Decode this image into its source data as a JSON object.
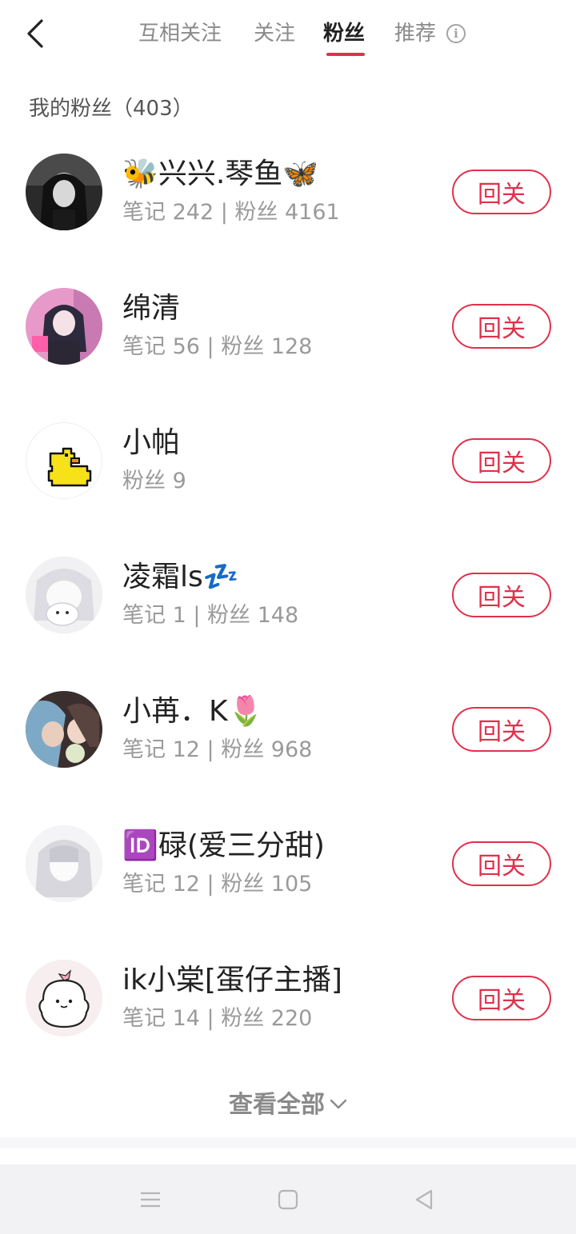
{
  "header": {
    "tabs": [
      {
        "label": "互相关注"
      },
      {
        "label": "关注"
      },
      {
        "label": "粉丝"
      },
      {
        "label": "推荐"
      }
    ],
    "active_tab": "粉丝",
    "info_glyph": "i"
  },
  "section": {
    "title": "我的粉丝（403）"
  },
  "fans": [
    {
      "name": "🐝兴兴.琴鱼🦋",
      "stats": "笔记 242 | 粉丝 4161",
      "button": "回关"
    },
    {
      "name": "绵清",
      "stats": "笔记 56 | 粉丝 128",
      "button": "回关"
    },
    {
      "name": "小帕",
      "stats": "粉丝 9",
      "button": "回关"
    },
    {
      "name": "凌霜ls💤",
      "stats": "笔记 1 | 粉丝 148",
      "button": "回关"
    },
    {
      "name": "小苒．K🌷",
      "stats": "笔记 12 | 粉丝 968",
      "button": "回关"
    },
    {
      "name": "🆔碌(爱三分甜)",
      "stats": "笔记 12 | 粉丝 105",
      "button": "回关"
    },
    {
      "name": "ik小棠[蛋仔主播]",
      "stats": "笔记 14 | 粉丝 220",
      "button": "回关"
    }
  ],
  "footer": {
    "view_all": "查看全部"
  },
  "colors": {
    "accent": "#e0314b",
    "muted_text": "#9a9a9a",
    "navbar_bg": "#f2f2f4"
  },
  "icons": {
    "back": "chevron-left-icon",
    "info": "info-icon",
    "expand": "chevron-down-icon",
    "nav_menu": "menu-icon",
    "nav_home": "square-icon",
    "nav_back": "triangle-back-icon"
  }
}
